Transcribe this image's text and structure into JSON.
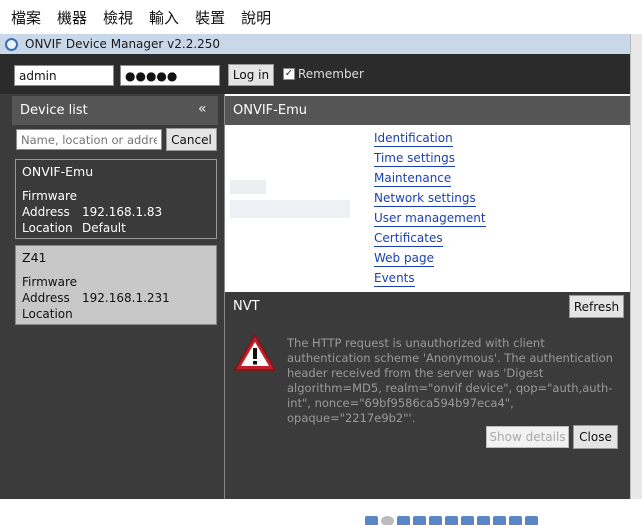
{
  "menubar": {
    "items": [
      "檔案",
      "機器",
      "檢視",
      "輸入",
      "裝置",
      "說明"
    ]
  },
  "window": {
    "title": "ONVIF Device Manager v2.2.250"
  },
  "login": {
    "username": "admin",
    "password": "●●●●●",
    "login_label": "Log in",
    "remember_label": "Remember",
    "remember_checked": true
  },
  "device_list": {
    "title": "Device list",
    "collapse_glyph": "«",
    "search_placeholder": "Name, location or address",
    "cancel_label": "Cancel",
    "devices": [
      {
        "name": "ONVIF-Emu",
        "firmware_label": "Firmware",
        "address_label": "Address",
        "address": "192.168.1.83",
        "location_label": "Location",
        "location": "Default"
      },
      {
        "name": "Z41",
        "firmware_label": "Firmware",
        "address_label": "Address",
        "address": "192.168.1.231",
        "location_label": "Location",
        "location": ""
      }
    ]
  },
  "device_panel": {
    "title": "ONVIF-Emu",
    "links": [
      "Identification",
      "Time settings",
      "Maintenance",
      "Network settings",
      "User management",
      "Certificates",
      "Web page",
      "Events"
    ]
  },
  "nvt": {
    "title": "NVT",
    "refresh_label": "Refresh",
    "message": "The HTTP request is unauthorized with client authentication scheme 'Anonymous'. The authentication header received from the server was 'Digest algorithm=MD5, realm=\"onvif device\", qop=\"auth,auth-int\", nonce=\"69bf9586ca594b97eca4\", opaque=\"2217e9b2\"'.",
    "show_details_label": "Show details",
    "close_label": "Close"
  },
  "colors": {
    "dark_panel": "#3b3b3b",
    "header_gray": "#555555",
    "link_blue": "#1a3fb0",
    "warning_red": "#c0202a"
  }
}
